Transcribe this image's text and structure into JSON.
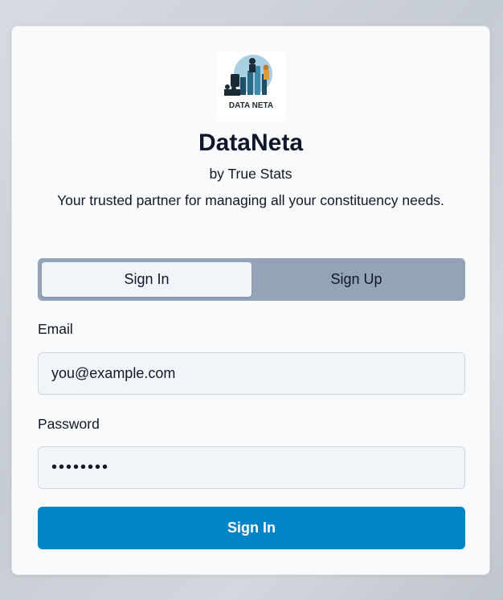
{
  "brand": {
    "logo_text": "DATA NETA",
    "name": "DataNeta",
    "byline": "by True Stats",
    "tagline": "Your trusted partner for managing all your constituency needs."
  },
  "tabs": [
    {
      "label": "Sign In",
      "active": true
    },
    {
      "label": "Sign Up",
      "active": false
    }
  ],
  "form": {
    "email_label": "Email",
    "email_value": "you@example.com",
    "password_label": "Password",
    "password_value": "••••••••",
    "submit_label": "Sign In"
  },
  "colors": {
    "primary": "#0284c7",
    "tab_bar": "#94a3b8",
    "card": "#f8fafc"
  }
}
